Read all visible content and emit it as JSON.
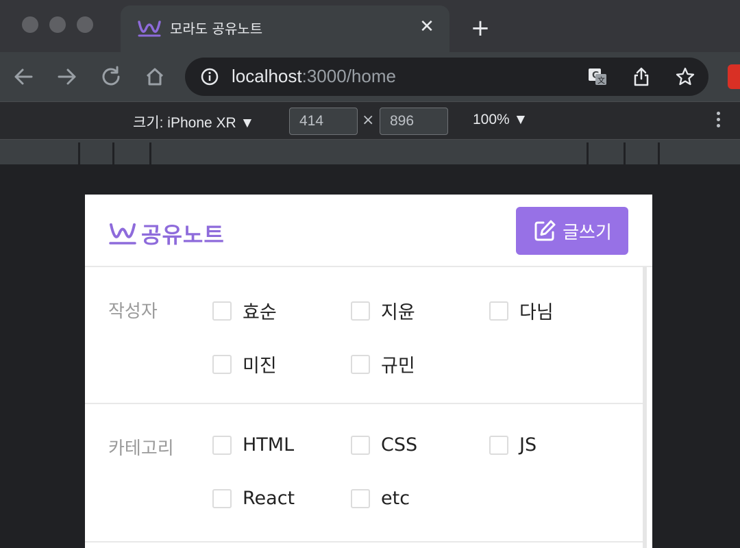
{
  "browser": {
    "tab_title": "모라도 공유노트",
    "url_host": "localhost",
    "url_path": ":3000/home",
    "colors": {
      "frame": "#35363a",
      "toolbar": "#3c4043",
      "omnibox": "#202124"
    }
  },
  "device_toolbar": {
    "device_label": "크기: iPhone XR ▼",
    "width": "414",
    "height": "896",
    "times": "×",
    "zoom_label": "100% ▼"
  },
  "app": {
    "brand_name": "공유노트",
    "write_button": "글쓰기",
    "accent_color": "#9771e6",
    "filters": {
      "author": {
        "label": "작성자",
        "options": [
          "효순",
          "지윤",
          "다님",
          "미진",
          "규민"
        ]
      },
      "category": {
        "label": "카테고리",
        "options": [
          "HTML",
          "CSS",
          "JS",
          "React",
          "etc"
        ]
      }
    }
  }
}
